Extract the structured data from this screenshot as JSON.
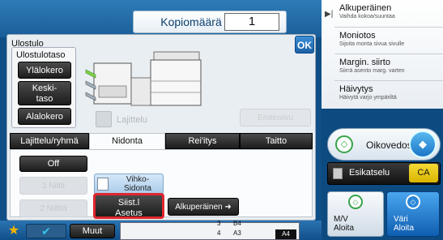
{
  "header": {
    "copies_label": "Kopiomäärä",
    "copies_value": "1"
  },
  "dialog": {
    "title": "Ulostulo",
    "ok_label": "OK",
    "tray_group_title": "Ulostulotaso",
    "tray_buttons": [
      "Ylälokero",
      "Keski-\ntaso",
      "Alalokero"
    ],
    "lajittelu_label": "Lajittelu",
    "erotinsivu_label": "Erotinsivu",
    "tabs": [
      {
        "label": "Lajittelu/ryhmä",
        "selected": false
      },
      {
        "label": "Nidonta",
        "selected": true
      },
      {
        "label": "Rei'itys",
        "selected": false
      },
      {
        "label": "Taitto",
        "selected": false
      }
    ],
    "staple": {
      "off_label": "Off",
      "one_label": "1 Niitti",
      "two_label": "2 Niittiä",
      "vihko_label": "Vihko-\nSidonta",
      "siist_label": "Siist.l\nAsetus",
      "original_label": "Alkuperäinen"
    }
  },
  "bottom_bar": {
    "muut_label": "Muut",
    "status": {
      "r1_num": "3",
      "r1_size": "B4",
      "r2_num": "4",
      "r2_size": "A3",
      "paper": "A4"
    }
  },
  "right_panel": {
    "items": [
      {
        "title": "Alkuperäinen",
        "subtitle": "Vaihda kokoa/suuntaa"
      },
      {
        "title": "Moniotos",
        "subtitle": "Sijoita monta sivua sivulle"
      },
      {
        "title": "Margin. siirto",
        "subtitle": "Siirrä asento marg. varten"
      },
      {
        "title": "Häivytys",
        "subtitle": "Häivytä varjo ympäriltä"
      }
    ],
    "oikovedos_label": "Oikovedos",
    "esikatselu_label": "Esikatselu",
    "ca_label": "CA",
    "mv_label": "M/V\nAloita",
    "vari_label": "Väri\nAloita"
  },
  "colors": {
    "accent_blue": "#1b5fa6",
    "start_green": "#39a34a",
    "ca_yellow": "#d9b500",
    "selected_red": "#e1262d"
  }
}
